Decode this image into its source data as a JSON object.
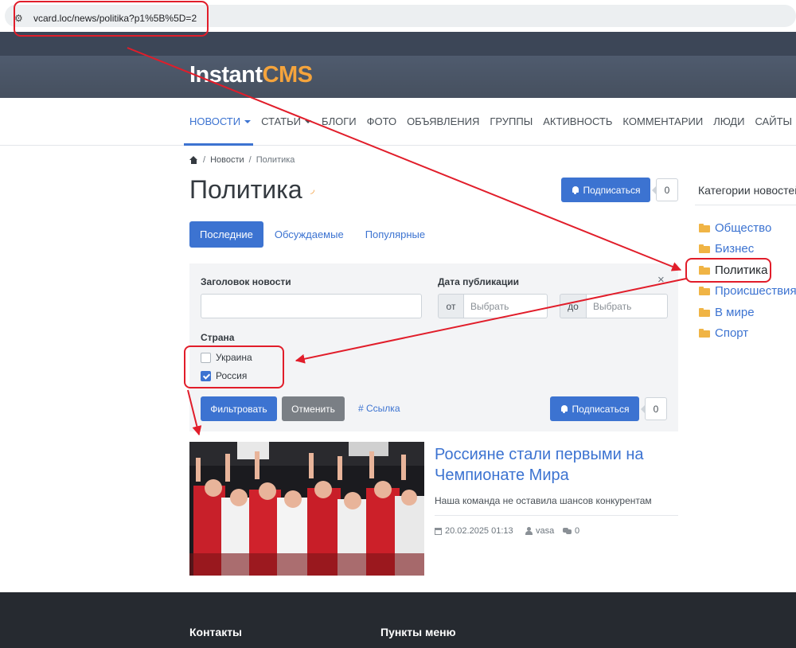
{
  "browser": {
    "url": "vcard.loc/news/politika?p1%5B%5D=2"
  },
  "logo": {
    "part1": "Instant",
    "part2": "CMS"
  },
  "nav": {
    "items": [
      {
        "label": "НОВОСТИ",
        "dropdown": true,
        "active": true
      },
      {
        "label": "СТАТЬИ",
        "dropdown": true
      },
      {
        "label": "БЛОГИ"
      },
      {
        "label": "ФОТО"
      },
      {
        "label": "ОБЪЯВЛЕНИЯ"
      },
      {
        "label": "ГРУППЫ"
      },
      {
        "label": "АКТИВНОСТЬ"
      },
      {
        "label": "КОММЕНТАРИИ"
      },
      {
        "label": "ЛЮДИ"
      },
      {
        "label": "САЙТЫ",
        "dropdown": true
      }
    ]
  },
  "breadcrumb": {
    "items": [
      "Новости",
      "Политика"
    ],
    "separator": "/"
  },
  "page": {
    "title": "Политика",
    "rss_icon": "rss-icon"
  },
  "subscribe": {
    "label": "Подписаться",
    "count": "0"
  },
  "tabs": [
    {
      "label": "Последние",
      "active": true
    },
    {
      "label": "Обсуждаемые"
    },
    {
      "label": "Популярные"
    }
  ],
  "filter": {
    "title_label": "Заголовок новости",
    "title_value": "",
    "date_label": "Дата публикации",
    "date_from_prefix": "от",
    "date_to_prefix": "до",
    "date_placeholder": "Выбрать",
    "close": "×",
    "country_label": "Страна",
    "countries": [
      {
        "label": "Украина",
        "checked": false
      },
      {
        "label": "Россия",
        "checked": true
      }
    ],
    "filter_button": "Фильтровать",
    "cancel_button": "Отменить",
    "link_label": "# Ссылка"
  },
  "article": {
    "title": "Россияне стали первыми на Чемпионате Мира",
    "description": "Наша команда не оставила шансов конкурентам",
    "date": "20.02.2025 01:13",
    "author": "vasa",
    "comments": "0"
  },
  "sidebar": {
    "title": "Категории новостей",
    "categories": [
      {
        "label": "Общество"
      },
      {
        "label": "Бизнес"
      },
      {
        "label": "Политика",
        "active": true
      },
      {
        "label": "Происшествия"
      },
      {
        "label": "В мире"
      },
      {
        "label": "Спорт"
      }
    ]
  },
  "footer": {
    "col1": "Контакты",
    "col2": "Пункты меню"
  },
  "colors": {
    "accent": "#3c73d1",
    "logo_orange": "#f5a43c",
    "header_dark": "#3c4657",
    "annotation_red": "#e11d2a",
    "footer_bg": "#262a30"
  }
}
